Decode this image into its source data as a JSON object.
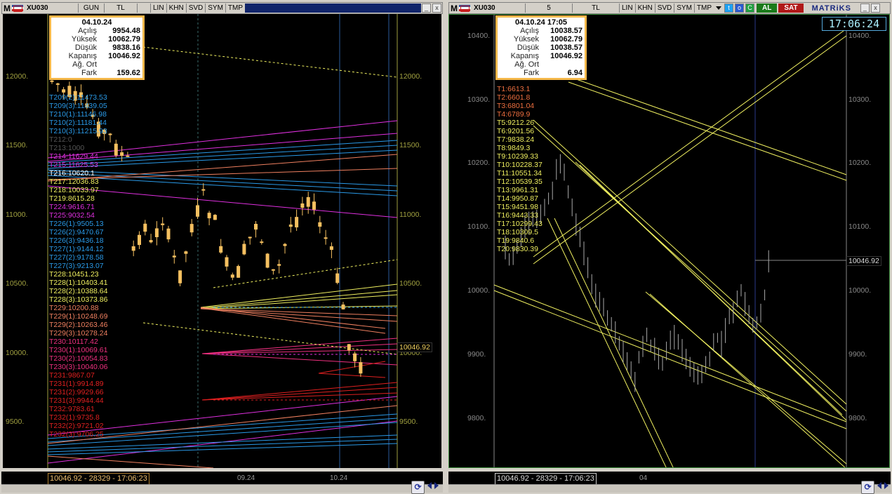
{
  "left": {
    "toolbar": {
      "m": "M",
      "symbol": "XU030",
      "period": "GUN",
      "currency": "TL",
      "buttons": [
        "LIN",
        "KHN",
        "SVD",
        "SYM",
        "TMP"
      ]
    },
    "info": {
      "date": "04.10.24",
      "rows": [
        {
          "k": "Açılış",
          "v": "9954.48"
        },
        {
          "k": "Yüksek",
          "v": "10062.79"
        },
        {
          "k": "Düşük",
          "v": "9838.16"
        },
        {
          "k": "Kapanış",
          "v": "10046.92"
        },
        {
          "k": "Ağ. Ort",
          "v": ""
        },
        {
          "k": "Fark",
          "v": "159.62"
        }
      ]
    },
    "y_labels": [
      "12000.",
      "11500.",
      "11000.",
      "10500.",
      "10000.",
      "9500."
    ],
    "last_price": "10046.92",
    "annotations": [
      {
        "t": "T209(2):11473.53",
        "c": "#2a9ae8"
      },
      {
        "t": "T209(3):11439.05",
        "c": "#2a9ae8"
      },
      {
        "t": "T210(1):11146.98",
        "c": "#2a9ae8"
      },
      {
        "t": "T210(2):11181.44",
        "c": "#2a9ae8"
      },
      {
        "t": "T210(3):11215.93",
        "c": "#2a9ae8"
      },
      {
        "t": "T212:0",
        "c": "#555555"
      },
      {
        "t": "T213:1000",
        "c": "#555555"
      },
      {
        "t": "T214:11629.44",
        "c": "#e030e0"
      },
      {
        "t": "T215:11625.53",
        "c": "#e030e0"
      },
      {
        "t": "T216:10620.1",
        "c": "#ffffff"
      },
      {
        "t": "T217:12036.83",
        "c": "#f0f060"
      },
      {
        "t": "T218:10033.97",
        "c": "#f0f060"
      },
      {
        "t": "T219:8615.28",
        "c": "#f0f060"
      },
      {
        "t": "T224:9616.71",
        "c": "#e030e0"
      },
      {
        "t": "T225:9032.54",
        "c": "#e030e0"
      },
      {
        "t": "T226(1):9505.13",
        "c": "#2a9ae8"
      },
      {
        "t": "T226(2):9470.67",
        "c": "#2a9ae8"
      },
      {
        "t": "T226(3):9436.18",
        "c": "#2a9ae8"
      },
      {
        "t": "T227(1):9144.12",
        "c": "#2a9ae8"
      },
      {
        "t": "T227(2):9178.58",
        "c": "#2a9ae8"
      },
      {
        "t": "T227(3):9213.07",
        "c": "#2a9ae8"
      },
      {
        "t": "T228:10451.23",
        "c": "#f0f060"
      },
      {
        "t": "T228(1):10403.41",
        "c": "#f0f060"
      },
      {
        "t": "T228(2):10388.64",
        "c": "#f0f060"
      },
      {
        "t": "T228(3):10373.86",
        "c": "#f0f060"
      },
      {
        "t": "T229:10200.88",
        "c": "#f08060"
      },
      {
        "t": "T229(1):10248.69",
        "c": "#f08060"
      },
      {
        "t": "T229(2):10263.46",
        "c": "#f08060"
      },
      {
        "t": "T229(3):10278.24",
        "c": "#f08060"
      },
      {
        "t": "T230:10117.42",
        "c": "#f03080"
      },
      {
        "t": "T230(1):10069.61",
        "c": "#f03080"
      },
      {
        "t": "T230(2):10054.83",
        "c": "#f03080"
      },
      {
        "t": "T230(3):10040.06",
        "c": "#f03080"
      },
      {
        "t": "T231:9867.07",
        "c": "#e02020"
      },
      {
        "t": "T231(1):9914.89",
        "c": "#e02020"
      },
      {
        "t": "T231(2):9929.66",
        "c": "#e02020"
      },
      {
        "t": "T231(3):9944.44",
        "c": "#e02020"
      },
      {
        "t": "T232:9783.61",
        "c": "#e02020"
      },
      {
        "t": "T232(1):9735.8",
        "c": "#e02020"
      },
      {
        "t": "T232(2):9721.02",
        "c": "#e02020"
      },
      {
        "t": "T232(3):9706.25",
        "c": "#e02020"
      }
    ],
    "status_value": "10046.92 - 28329 - 17:06:23",
    "x_dates": [
      "09.24",
      "10.24"
    ]
  },
  "right": {
    "toolbar": {
      "m": "M",
      "symbol": "XU030",
      "period": "5",
      "currency": "TL",
      "buttons": [
        "LIN",
        "KHN",
        "SVD",
        "SYM",
        "TMP"
      ],
      "buy": "AL",
      "sell": "SAT",
      "brand": "MATRiKS"
    },
    "info": {
      "date": "04.10.24 17:05",
      "rows": [
        {
          "k": "Açılış",
          "v": "10038.57"
        },
        {
          "k": "Yüksek",
          "v": "10062.79"
        },
        {
          "k": "Düşük",
          "v": "10038.57"
        },
        {
          "k": "Kapanış",
          "v": "10046.92"
        },
        {
          "k": "Ağ. Ort",
          "v": ""
        },
        {
          "k": "Fark",
          "v": "6.94"
        }
      ]
    },
    "clock": "17:06:24",
    "y_labels": [
      "10400.",
      "10300.",
      "10200.",
      "10100.",
      "10000.",
      "9900.",
      "9800."
    ],
    "last_price": "10046.92",
    "annotations": [
      {
        "t": "T1:6613.1",
        "c": "#f07040"
      },
      {
        "t": "T2:6601.8",
        "c": "#f07040"
      },
      {
        "t": "T3:6801.04",
        "c": "#f07040"
      },
      {
        "t": "T4:6789.9",
        "c": "#f07040"
      },
      {
        "t": "T5:9212.26",
        "c": "#f0f060"
      },
      {
        "t": "T6:9201.56",
        "c": "#f0f060"
      },
      {
        "t": "T7:9838.24",
        "c": "#f0f060"
      },
      {
        "t": "T8:9849.3",
        "c": "#f0f060"
      },
      {
        "t": "T9:10239.33",
        "c": "#f0f060"
      },
      {
        "t": "T10:10228.37",
        "c": "#f0f060"
      },
      {
        "t": "T11:10551.34",
        "c": "#f0f060"
      },
      {
        "t": "T12:10539.35",
        "c": "#f0f060"
      },
      {
        "t": "T13:9961.31",
        "c": "#f0f060"
      },
      {
        "t": "T14:9950.87",
        "c": "#f0f060"
      },
      {
        "t": "T15:9451.98",
        "c": "#f0f060"
      },
      {
        "t": "T16:9443.33",
        "c": "#f0f060"
      },
      {
        "t": "T17:10299.43",
        "c": "#f0f060"
      },
      {
        "t": "T18:10309.5",
        "c": "#f0f060"
      },
      {
        "t": "T19:9840.6",
        "c": "#f0f060"
      },
      {
        "t": "T20:9830.39",
        "c": "#f0f060"
      }
    ],
    "status_value": "10046.92 - 28329 - 17:06:23",
    "x_dates": [
      "04"
    ]
  }
}
